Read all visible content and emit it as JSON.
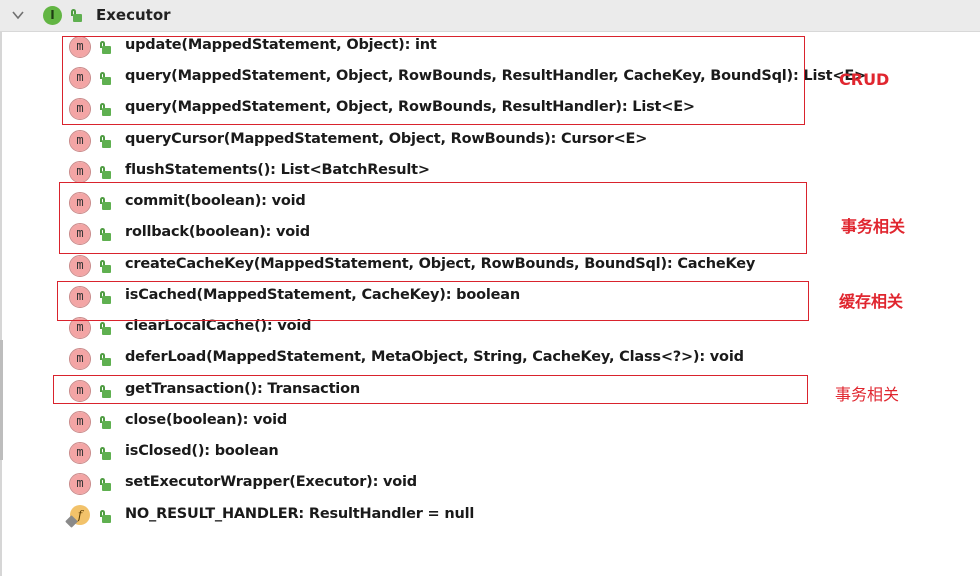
{
  "header": {
    "interface_icon_letter": "I",
    "title": "Executor"
  },
  "members": [
    {
      "icon": "m",
      "signature": "update(MappedStatement, Object): int"
    },
    {
      "icon": "m",
      "signature": "query(MappedStatement, Object, RowBounds, ResultHandler, CacheKey, BoundSql): List<E>"
    },
    {
      "icon": "m",
      "signature": "query(MappedStatement, Object, RowBounds, ResultHandler): List<E>"
    },
    {
      "icon": "m",
      "signature": "queryCursor(MappedStatement, Object, RowBounds): Cursor<E>"
    },
    {
      "icon": "m",
      "signature": "flushStatements(): List<BatchResult>"
    },
    {
      "icon": "m",
      "signature": "commit(boolean): void"
    },
    {
      "icon": "m",
      "signature": "rollback(boolean): void"
    },
    {
      "icon": "m",
      "signature": "createCacheKey(MappedStatement, Object, RowBounds, BoundSql): CacheKey"
    },
    {
      "icon": "m",
      "signature": "isCached(MappedStatement, CacheKey): boolean"
    },
    {
      "icon": "m",
      "signature": "clearLocalCache(): void"
    },
    {
      "icon": "m",
      "signature": "deferLoad(MappedStatement, MetaObject, String, CacheKey, Class<?>): void"
    },
    {
      "icon": "m",
      "signature": "getTransaction(): Transaction"
    },
    {
      "icon": "m",
      "signature": "close(boolean): void"
    },
    {
      "icon": "m",
      "signature": "isClosed(): boolean"
    },
    {
      "icon": "m",
      "signature": "setExecutorWrapper(Executor): void"
    },
    {
      "icon": "f",
      "signature": "NO_RESULT_HANDLER: ResultHandler = null"
    }
  ],
  "annotations": {
    "crud": "CRUD",
    "transaction_1": "事务相关",
    "cache": "缓存相关",
    "transaction_2": "事务相关"
  },
  "colors": {
    "annotation_red": "#e0262f",
    "method_icon": "#f3a5a5",
    "field_icon": "#f2c26a",
    "interface_icon": "#62b543",
    "lock_green": "#5fb050"
  }
}
